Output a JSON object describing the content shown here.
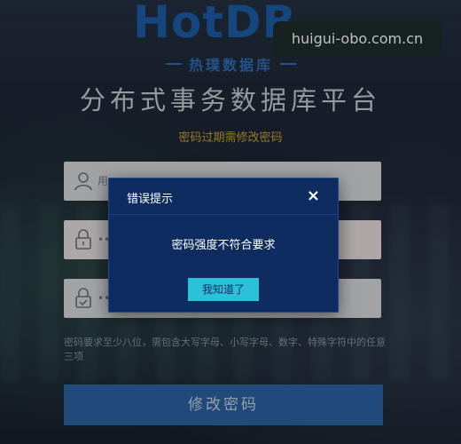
{
  "brand": {
    "logo_text": "HotDB",
    "logo_subtitle": "热璞数据库"
  },
  "watermark": "huigui-obo.com.cn",
  "page": {
    "title": "分布式事务数据库平台",
    "expire_note": "密码过期需修改密码"
  },
  "form": {
    "username_value": "用",
    "password_value": "•••",
    "confirm_value": "•••",
    "hint": "密码要求至少八位，需包含大写字母、小写字母、数字、特殊字符中的任意三项",
    "submit_label": "修改密码"
  },
  "dialog": {
    "title": "错误提示",
    "close_glyph": "×",
    "message": "密码强度不符合要求",
    "confirm_label": "我知道了"
  },
  "colors": {
    "accent": "#2bc1d8",
    "dialog_bg": "#0e2c5f",
    "warning_text": "#c8a23c",
    "submit_bg": "#2b63a3"
  }
}
